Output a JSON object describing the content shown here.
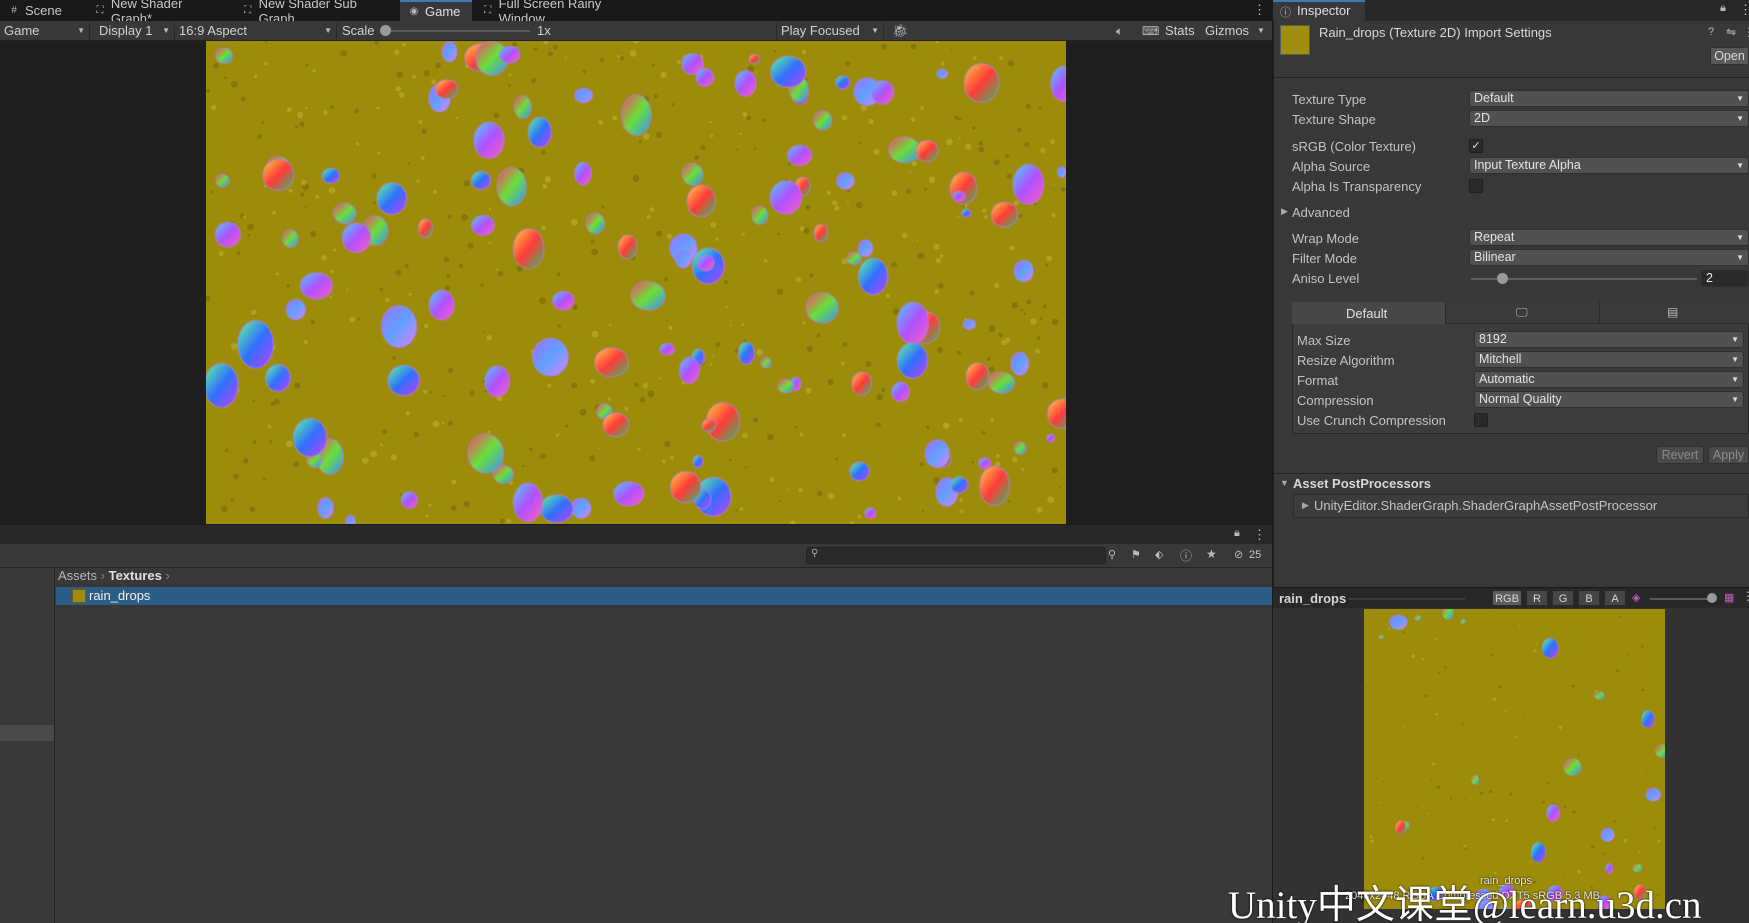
{
  "tabs": [
    {
      "label": "Scene",
      "icon": "hash-icon"
    },
    {
      "label": "New Shader Graph*",
      "icon": "shader-graph-icon"
    },
    {
      "label": "New Shader Sub Graph",
      "icon": "shader-graph-icon"
    },
    {
      "label": "Game",
      "icon": "gamepad-icon",
      "active": true
    },
    {
      "label": "Full Screen Rainy Window",
      "icon": "shader-graph-icon"
    }
  ],
  "game_toolbar": {
    "display_mode": "Game",
    "display": "Display 1",
    "aspect": "16:9 Aspect",
    "scale_label": "Scale",
    "scale_value": "1x",
    "play_mode": "Play Focused",
    "stats": "Stats",
    "gizmos": "Gizmos"
  },
  "project": {
    "breadcrumb": [
      "Assets",
      "Textures"
    ],
    "items": [
      {
        "name": "rain_drops",
        "selected": true
      }
    ],
    "hidden_count": "25"
  },
  "inspector": {
    "tab_label": "Inspector",
    "title": "Rain_drops (Texture 2D) Import Settings",
    "open_button": "Open",
    "properties": [
      {
        "label": "Texture Type",
        "value": "Default"
      },
      {
        "label": "Texture Shape",
        "value": "2D"
      }
    ],
    "srgb_label": "sRGB (Color Texture)",
    "srgb_checked": true,
    "alpha_source_label": "Alpha Source",
    "alpha_source_value": "Input Texture Alpha",
    "alpha_transparency_label": "Alpha Is Transparency",
    "advanced_label": "Advanced",
    "wrap_label": "Wrap Mode",
    "wrap_value": "Repeat",
    "filter_label": "Filter Mode",
    "filter_value": "Bilinear",
    "aniso_label": "Aniso Level",
    "aniso_value": "2",
    "platform_tabs": [
      "Default"
    ],
    "platform": [
      {
        "label": "Max Size",
        "value": "8192"
      },
      {
        "label": "Resize Algorithm",
        "value": "Mitchell"
      },
      {
        "label": "Format",
        "value": "Automatic"
      },
      {
        "label": "Compression",
        "value": "Normal Quality"
      }
    ],
    "crunch_label": "Use Crunch Compression",
    "revert": "Revert",
    "apply": "Apply",
    "postprocessors_label": "Asset PostProcessors",
    "postprocessor_item": "UnityEditor.ShaderGraph.ShaderGraphAssetPostProcessor"
  },
  "preview": {
    "name": "rain_drops",
    "channels": [
      "RGB",
      "R",
      "G",
      "B",
      "A"
    ],
    "caption_name": "rain_drops",
    "caption_info": "2048x2048 RGBA Compressed DXT5 sRGB 5.3 MB"
  },
  "watermark": "Unity中文课堂@learn.u3d.cn",
  "colors": {
    "texture_base": "#9c8c0a",
    "selection": "#2c5d87",
    "active_tab_accent": "#3a79bb"
  }
}
